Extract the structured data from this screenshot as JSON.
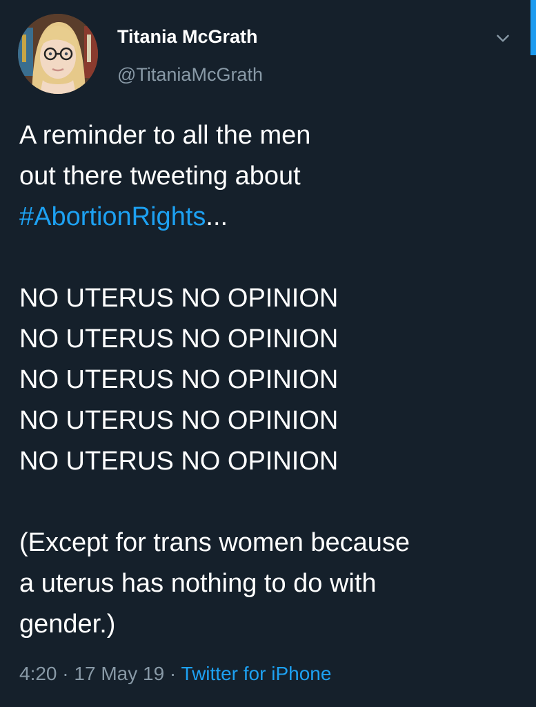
{
  "author": {
    "display_name": "Titania McGrath",
    "handle": "@TitaniaMcGrath"
  },
  "tweet": {
    "intro_line_1": "A reminder to all the men",
    "intro_line_2": "out there tweeting about",
    "hashtag": "#AbortionRights",
    "hashtag_suffix": "...",
    "repeated_lines": [
      "NO UTERUS NO OPINION",
      "NO UTERUS NO OPINION",
      "NO UTERUS NO OPINION",
      "NO UTERUS NO OPINION",
      "NO UTERUS NO OPINION"
    ],
    "closing_lines": [
      "(Except for trans women because",
      "a uterus has nothing to do with",
      "gender.)"
    ]
  },
  "meta": {
    "time": "4:20",
    "separator": "·",
    "date": "17 May 19",
    "source": "Twitter for iPhone"
  },
  "icons": {
    "menu": "chevron-down-icon"
  },
  "colors": {
    "background": "#15202b",
    "text": "#ffffff",
    "secondary": "#8899a6",
    "link": "#1da1f2"
  }
}
